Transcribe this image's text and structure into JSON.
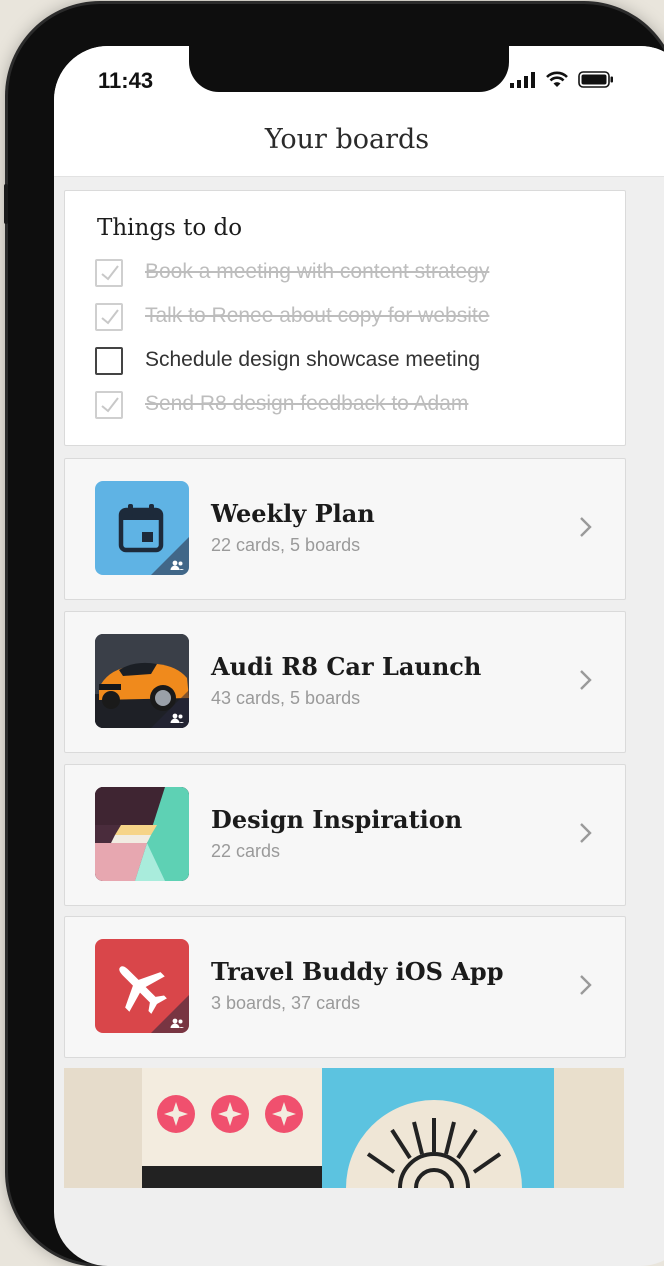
{
  "status_bar": {
    "time": "11:43"
  },
  "header": {
    "title": "Your boards"
  },
  "todo": {
    "title": "Things to do",
    "items": [
      {
        "text": "Book a meeting with content strategy",
        "done": true
      },
      {
        "text": "Talk to Renee about copy for website",
        "done": true
      },
      {
        "text": "Schedule design showcase meeting",
        "done": false
      },
      {
        "text": "Send R8 design feedback to Adam",
        "done": true
      }
    ]
  },
  "boards": [
    {
      "title": "Weekly Plan",
      "subtitle": "22 cards, 5 boards",
      "icon": "calendar-icon",
      "color": "#5fb3e4",
      "shared": true
    },
    {
      "title": "Audi R8 Car Launch",
      "subtitle": "43 cards, 5 boards",
      "icon": "car-photo",
      "color": "#2a2e36",
      "shared": true
    },
    {
      "title": "Design Inspiration",
      "subtitle": "22 cards",
      "icon": "geometric-art",
      "color": "#4a2c3c",
      "shared": false
    },
    {
      "title": "Travel Buddy iOS App",
      "subtitle": "3 boards, 37 cards",
      "icon": "airplane-icon",
      "color": "#d9464a",
      "shared": true
    }
  ],
  "colors": {
    "accent_check": "#cfcfcf",
    "background": "#efefef"
  }
}
